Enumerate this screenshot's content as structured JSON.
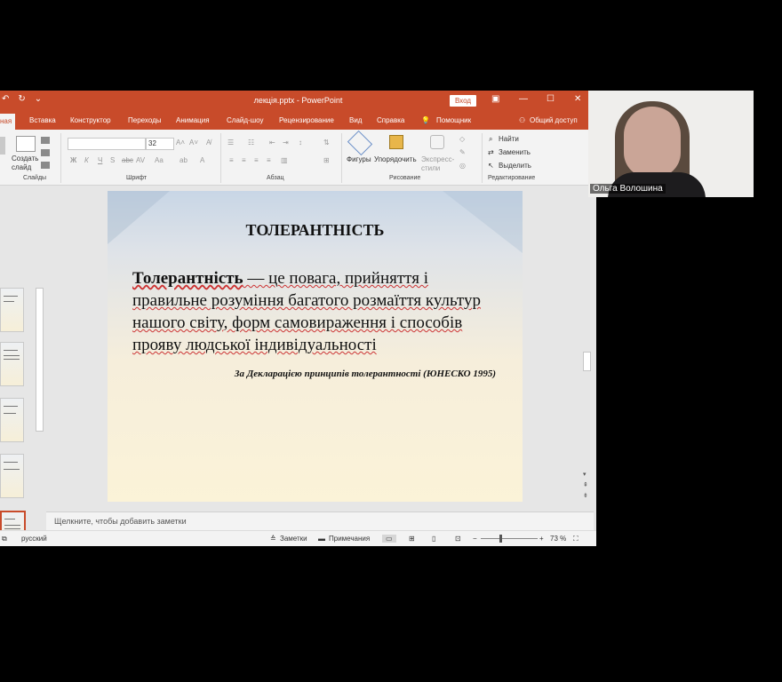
{
  "window": {
    "title": "лекція.pptx  -  PowerPoint",
    "login_label": "Вход"
  },
  "tabs": [
    "ная",
    "Вставка",
    "Конструктор",
    "Переходы",
    "Анимация",
    "Слайд-шоу",
    "Рецензирование",
    "Вид",
    "Справка",
    "Помощник",
    "Общий доступ"
  ],
  "ribbon": {
    "create_slide": "Создать\nслайд",
    "group_slides": "Слайды",
    "font_size": "32",
    "group_font": "Шрифт",
    "group_paragraph": "Абзац",
    "shapes": "Фигуры",
    "arrange": "Упорядочить",
    "express": "Экспресс-\nстили",
    "group_drawing": "Рисование",
    "find": "Найти",
    "replace": "Заменить",
    "select": "Выделить",
    "group_editing": "Редактирование"
  },
  "slide": {
    "title": "ТОЛЕРАНТНІСТЬ",
    "body_bold": "Толерантність",
    "body_rest": " — це повага, прийняття і правильне розуміння багатого розмаїття культур нашого світу, форм самовираження і способів прояву людської індивідуальності",
    "source": "За Декларацією принципів толерантності (ЮНЕСКО  1995)"
  },
  "notes_placeholder": "Щелкните, чтобы добавить заметки",
  "status": {
    "language": "русский",
    "notes": "Заметки",
    "comments": "Примечания",
    "zoom": "73 %"
  },
  "video": {
    "participant_name": "Ольга Волошина"
  },
  "colors": {
    "accent": "#c84b2a"
  }
}
